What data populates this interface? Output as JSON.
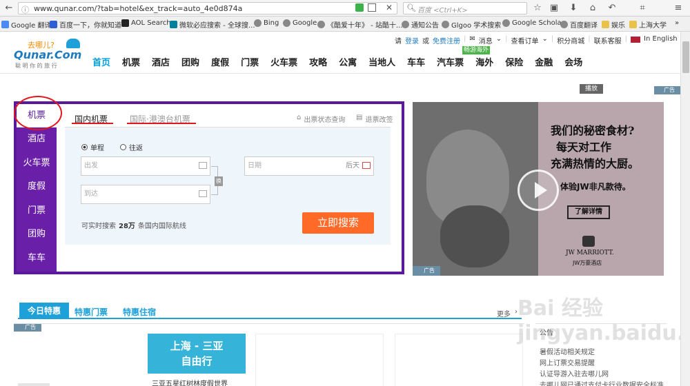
{
  "browser": {
    "url": "www.qunar.com/?tab=hotel&ex_track=auto_4e0d874a",
    "search_placeholder": "百度 <Ctrl+K>",
    "bookmarks": [
      {
        "label": "Google 翻译",
        "color": "#4a8af4"
      },
      {
        "label": "百度一下，你就知道",
        "color": "#2b60d6"
      },
      {
        "label": "AOL Search",
        "color": "#222222"
      },
      {
        "label": "微软必应搜索 - 全球搜...",
        "color": "#00809d"
      },
      {
        "label": "Bing",
        "color": "#888888"
      },
      {
        "label": "Google",
        "color": "#888888"
      },
      {
        "label": "《酷爱十年》 - 站酷十...",
        "color": "#888888"
      },
      {
        "label": "通知公告",
        "color": "#888888"
      },
      {
        "label": "Glgoo 学术搜索",
        "color": "#888888"
      },
      {
        "label": "Google Scholar",
        "color": "#888888"
      },
      {
        "label": "百度翻译",
        "color": "#888888"
      },
      {
        "label": "娱乐",
        "color": "#e8c24a"
      },
      {
        "label": "上海大学",
        "color": "#e8c24a"
      }
    ]
  },
  "logo": {
    "brand": "Qunar.Com",
    "tag": "去哪儿?",
    "slogan": "聪 明 你 的 旅 行"
  },
  "topbar": {
    "prompt": "请",
    "login": "登录",
    "or": "或",
    "register": "免费注册",
    "messages": "消息",
    "orders": "查看订单",
    "points": "积分商城",
    "service": "联系客服",
    "english": "In English"
  },
  "mainnav": {
    "items": [
      "首页",
      "机票",
      "酒店",
      "团购",
      "度假",
      "门票",
      "火车票",
      "攻略",
      "公寓",
      "当地人",
      "车车",
      "汽车票",
      "海外",
      "保险",
      "金融",
      "会场"
    ],
    "badge": "畅游海外"
  },
  "side_tabs": [
    "机票",
    "酒店",
    "火车票",
    "度假",
    "门票",
    "团购",
    "车车"
  ],
  "flight": {
    "tab_domestic": "国内机票",
    "tab_intl": "国际·港澳台机票",
    "status_link": "出票状态查询",
    "refund_link": "退票改签",
    "oneway": "单程",
    "roundtrip": "往返",
    "from_placeholder": "出发",
    "to_placeholder": "到达",
    "date_placeholder": "日期",
    "date_suffix": "后天",
    "swap": "换",
    "stats_prefix": "可实时搜索",
    "stats_count": "28万",
    "stats_suffix": "条国内国际航线",
    "search_button": "立即搜索"
  },
  "ad": {
    "play_label": "播放",
    "ad_label": "广告",
    "headline_1": "我们的秘密食材?",
    "headline_2": "每天对工作",
    "headline_3": "充满热情的大厨。",
    "sub": "体验JW非凡款待。",
    "cta": "了解详情",
    "brand": "JW MARRIOTT.",
    "brand_cn": "JW万豪酒店"
  },
  "deals": {
    "tabs": [
      "今日特惠",
      "特惠门票",
      "特惠住宿"
    ],
    "more": "更多",
    "ad_label": "广告",
    "promo_1": "上海 - 三亚",
    "promo_2": "自由行",
    "promo_sub": "三亚五星红树林度假世界"
  },
  "notice": {
    "title": "公告",
    "items": [
      "暑假活动相关规定",
      "网上订票交易提醒",
      "认证导游入驻去哪儿网",
      "去哪儿网已通过支付卡行业数据安全标准"
    ]
  },
  "watermark": "Bai 经验  jingyan.baidu.com"
}
